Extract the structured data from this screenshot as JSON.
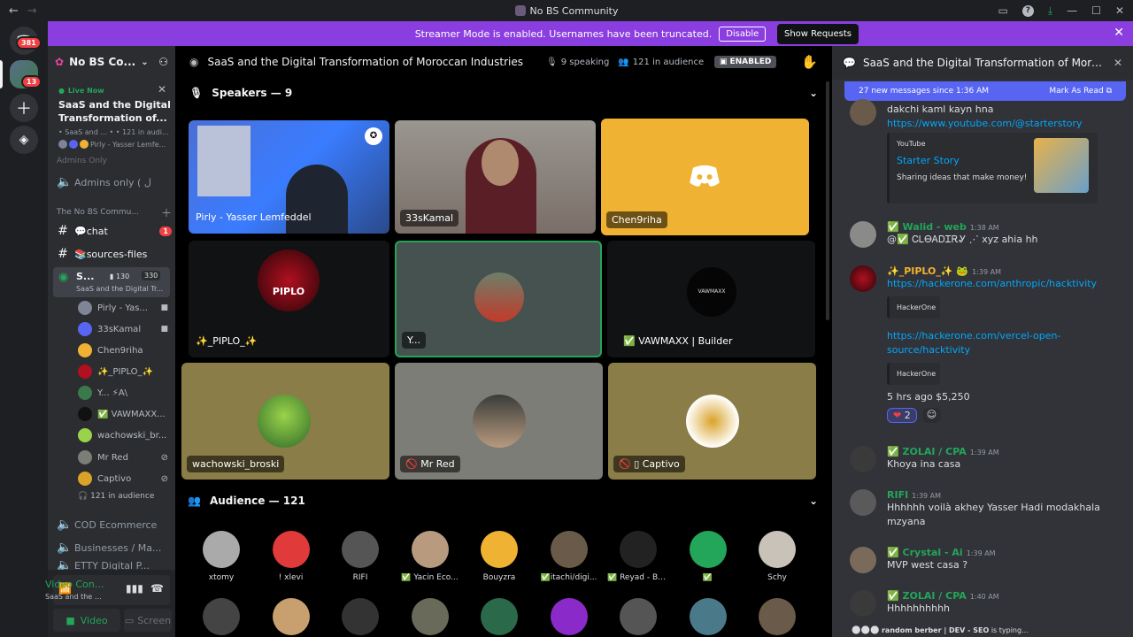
{
  "window": {
    "title": "No BS Community"
  },
  "rail": {
    "dm_badge": "381",
    "server_badge": "13"
  },
  "streamer": {
    "text": "Streamer Mode is enabled. Usernames have been truncated.",
    "disable": "Disable"
  },
  "tooltip": "Show Requests",
  "sidebar": {
    "server_name": "No BS Co...",
    "live_now": "Live Now",
    "live_title": "SaaS and the Digital Transformation of...",
    "live_meta": "• SaaS and ... •  • 121 in audience",
    "live_names": "Pirly - Yasser Lemfe...",
    "admins_cut": "Admins Only",
    "admins_only": "Admins only ( ل",
    "category": "The No BS Commu...",
    "chat": "💬chat",
    "chat_badge": "1",
    "sources": "📚sources-files",
    "stage_short": "S...",
    "stage_count1": "130",
    "stage_count2": "330",
    "stage_sub": "SaaS and the Digital Tr...",
    "users": [
      "Pirly - Yas...",
      "33sKamal",
      "Chen9riha",
      "✨_PIPLO_✨",
      "Y... ⚡A\\",
      "✅ VAWMAXX...",
      "wachowski_br...",
      "Mr Red",
      "Captivo"
    ],
    "audience": "121 in audience",
    "cod": "COD Ecommerce",
    "biz": "Businesses / Ma...",
    "cut": "ETTY Digital P..."
  },
  "voice": {
    "status": "Video Connecte",
    "sub": "SaaS and the Digit...",
    "video": "Video",
    "screen": "Screen"
  },
  "stage": {
    "title": "SaaS and the Digital Transformation of Moroccan Industries",
    "speaking": "9 speaking",
    "audience": "121 in audience",
    "enabled": "ENABLED",
    "speakers_header": "Speakers — 9",
    "audience_header": "Audience — 121",
    "tiles": [
      "Pirly - Yasser Lemfeddel",
      "33sKamal",
      "Chen9riha",
      "✨_PIPLO_✨",
      "Y...",
      "✅ VAWMAXX | Builder",
      "wachowski_broski",
      "Mr Red",
      "Captivo"
    ],
    "piplo_logo": "PIPLO",
    "vawmaxx_logo": "VAWMAXX",
    "audience_names": [
      "xtomy",
      "! xlevi",
      "RIFI",
      "✅ Yacin Eco...",
      "Bouyzra",
      "✅itachi/digi...",
      "✅ Reyad - BL...",
      "✅",
      "Schy"
    ]
  },
  "chat": {
    "title": "SaaS and the Digital Transformation of Moroccan In",
    "new_messages": "27 new messages since 1:36 AM",
    "mark_read": "Mark As Read",
    "m1_text": "dakchi kaml kayn hna",
    "m1_link": "https://www.youtube.com/@starterstory",
    "embed_provider": "YouTube",
    "embed_title": "Starter Story",
    "embed_desc": "Sharing ideas that make money!",
    "m2_name": "✅ Walid -  web",
    "m2_time": "1:38 AM",
    "m2_text": "@✅ ᏟᏞᎾᎪᎠᏆᎡᎽ ⋰ xyz  ahia hh",
    "m3_name": "✨_PIPLO_✨ 🐸",
    "m3_time": "1:39 AM",
    "m3_link1": "https://hackerone.com/anthropic/hacktivity",
    "m3_embed": "HackerOne",
    "m3_link2": "https://hackerone.com/vercel-open-source/hacktivity",
    "m3_text": "5 hrs ago $5,250",
    "m3_reaction": "2",
    "m4_name": "✅ ZOLAI / CPA",
    "m4_time": "1:39 AM",
    "m4_text": "Khoya ina casa",
    "m5_name": "RIFI",
    "m5_time": "1:39 AM",
    "m5_text": "Hhhhhh voilà akhey Yasser Hadi modakhala mzyana",
    "m6_name": "✅ Crystal - Ai",
    "m6_time": "1:39 AM",
    "m6_text": "MVP west casa ?",
    "m7_name": "✅ ZOLAI / CPA",
    "m7_time": "1:40 AM",
    "m7_text": "Hhhhhhhhhh",
    "typing": "random berber | DEV - SEO",
    "typing_suffix": "is typing..."
  },
  "colors": {
    "accent": "#5865f2",
    "streamer": "#8b3ee0",
    "green": "#23a55a",
    "chen_tile": "#f0b232",
    "olive": "#8a7d47"
  }
}
